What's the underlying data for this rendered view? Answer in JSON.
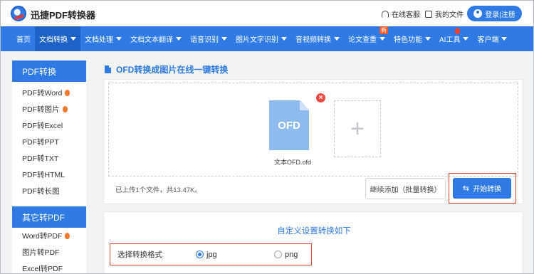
{
  "header": {
    "brand": "迅捷PDF转换器",
    "service_label": "在线客服",
    "files_label": "我的文件",
    "login_label": "登录|注册"
  },
  "nav": {
    "items": [
      {
        "label": "首页",
        "caret": false
      },
      {
        "label": "文档转换",
        "caret": true,
        "active": true
      },
      {
        "label": "文档处理",
        "caret": true
      },
      {
        "label": "文档文本翻译",
        "caret": true
      },
      {
        "label": "语音识别",
        "caret": true
      },
      {
        "label": "图片文字识别",
        "caret": true
      },
      {
        "label": "音视频转换",
        "caret": true
      },
      {
        "label": "论文查重",
        "caret": true,
        "badge": "新"
      },
      {
        "label": "特色功能",
        "caret": true
      },
      {
        "label": "AI工具",
        "caret": true,
        "hot": true
      },
      {
        "label": "客户端",
        "caret": true
      }
    ]
  },
  "sidebar": {
    "sections": [
      {
        "title": "PDF转换",
        "items": [
          {
            "label": "PDF转Word",
            "hot": true
          },
          {
            "label": "PDF转图片",
            "hot": true
          },
          {
            "label": "PDF转Excel"
          },
          {
            "label": "PDF转PPT"
          },
          {
            "label": "PDF转TXT"
          },
          {
            "label": "PDF转HTML"
          },
          {
            "label": "PDF转长图"
          }
        ]
      },
      {
        "title": "其它转PDF",
        "items": [
          {
            "label": "Word转PDF",
            "hot": true
          },
          {
            "label": "图片转PDF"
          },
          {
            "label": "Excel转PDF"
          }
        ]
      }
    ]
  },
  "main": {
    "title": "OFD转换成图片在线一键转换",
    "file": {
      "type_label": "OFD",
      "name": "文本OFD.ofd"
    },
    "add_symbol": "+",
    "delete_symbol": "×",
    "status": "已上传1个文件，共13.47K。",
    "continue_label": "继续添加（批量转换）",
    "start_label": "开始转换"
  },
  "settings": {
    "title": "自定义设置转换如下",
    "format_label": "选择转换格式",
    "options": [
      {
        "label": "jpg",
        "selected": true
      },
      {
        "label": "png",
        "selected": false
      }
    ]
  },
  "colors": {
    "brand_blue": "#2f7ae5",
    "highlight_red": "#e0442c"
  }
}
